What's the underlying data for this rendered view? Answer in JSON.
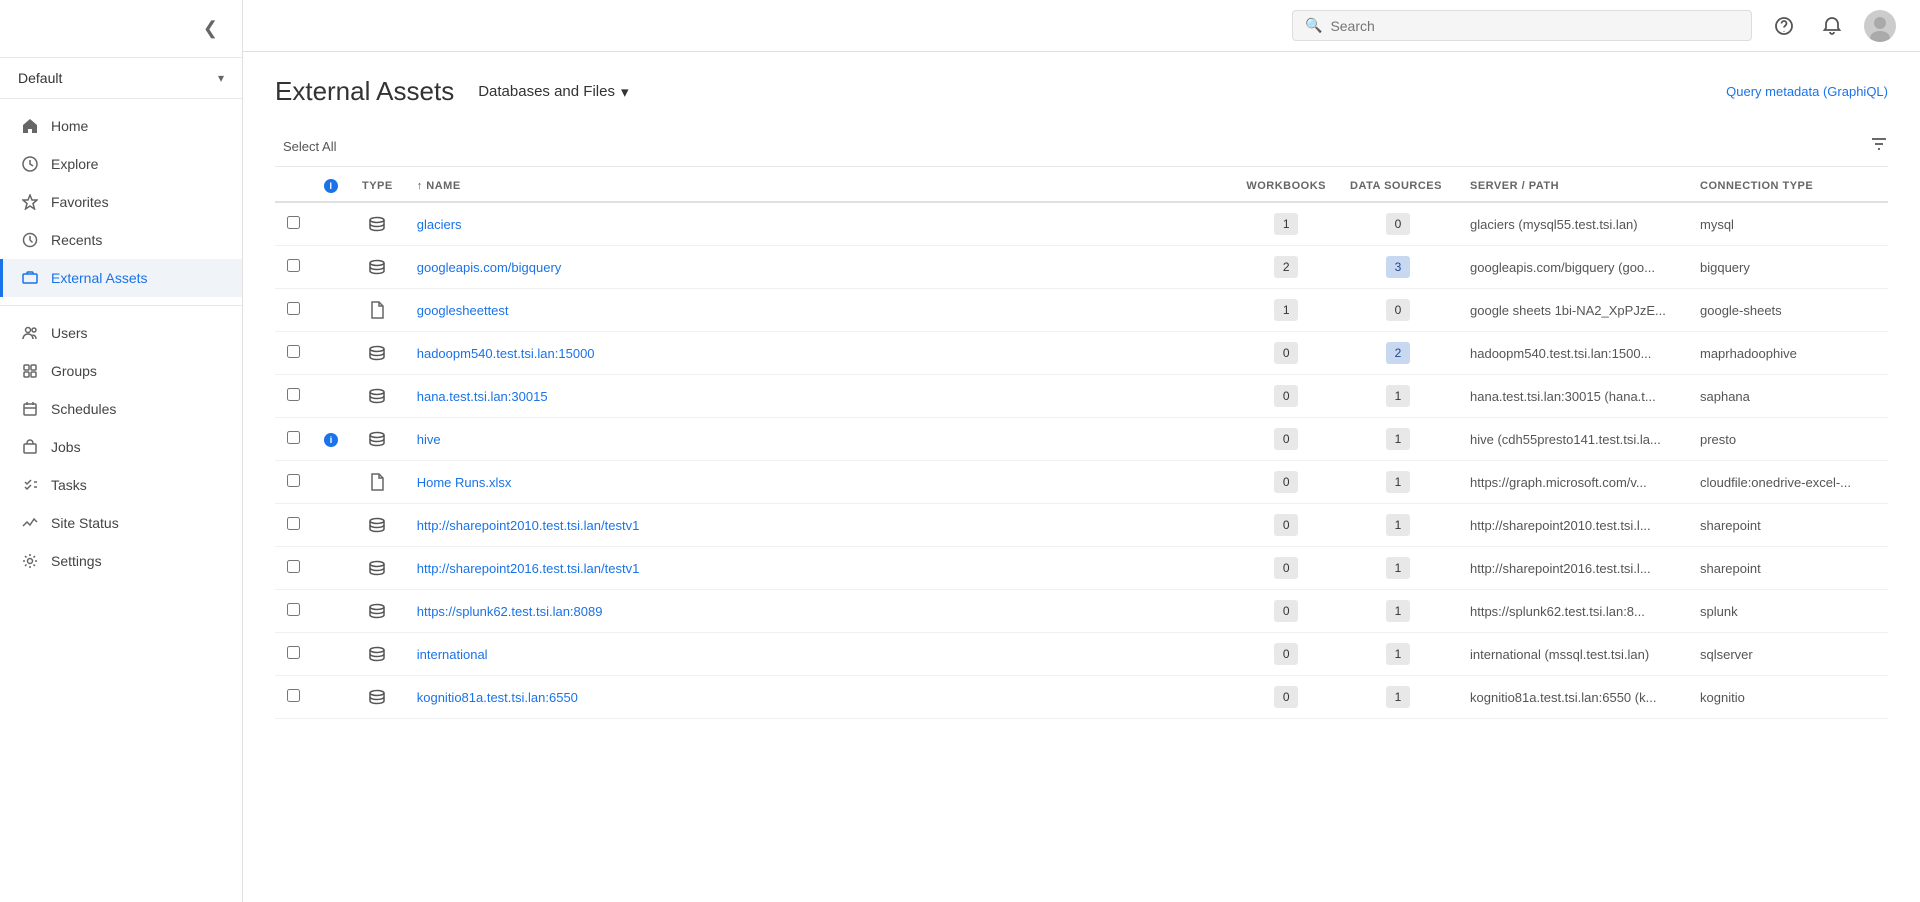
{
  "sidebar": {
    "env_label": "Default",
    "collapse_icon": "❮",
    "nav_items": [
      {
        "id": "home",
        "label": "Home",
        "icon": "home"
      },
      {
        "id": "explore",
        "label": "Explore",
        "icon": "explore"
      },
      {
        "id": "favorites",
        "label": "Favorites",
        "icon": "star"
      },
      {
        "id": "recents",
        "label": "Recents",
        "icon": "clock"
      },
      {
        "id": "external-assets",
        "label": "External Assets",
        "icon": "external",
        "active": true
      }
    ],
    "admin_items": [
      {
        "id": "users",
        "label": "Users",
        "icon": "users"
      },
      {
        "id": "groups",
        "label": "Groups",
        "icon": "groups"
      },
      {
        "id": "schedules",
        "label": "Schedules",
        "icon": "schedules"
      },
      {
        "id": "jobs",
        "label": "Jobs",
        "icon": "jobs"
      },
      {
        "id": "tasks",
        "label": "Tasks",
        "icon": "tasks"
      },
      {
        "id": "site-status",
        "label": "Site Status",
        "icon": "status"
      },
      {
        "id": "settings",
        "label": "Settings",
        "icon": "settings"
      }
    ]
  },
  "topbar": {
    "search_placeholder": "Search"
  },
  "page": {
    "title": "External Assets",
    "dropdown_label": "Databases and Files",
    "graphql_link": "Query metadata (GraphiQL)",
    "select_all_label": "Select All"
  },
  "table": {
    "columns": [
      {
        "id": "checkbox",
        "label": ""
      },
      {
        "id": "info",
        "label": ""
      },
      {
        "id": "type",
        "label": "Type"
      },
      {
        "id": "name",
        "label": "Name",
        "sort": "asc"
      },
      {
        "id": "workbooks",
        "label": "Workbooks"
      },
      {
        "id": "datasources",
        "label": "Data Sources"
      },
      {
        "id": "server",
        "label": "Server / Path"
      },
      {
        "id": "conntype",
        "label": "Connection Type"
      }
    ],
    "rows": [
      {
        "id": 1,
        "type": "database",
        "name": "glaciers",
        "workbooks": 1,
        "workbooks_highlighted": false,
        "datasources": 0,
        "datasources_highlighted": false,
        "server": "glaciers (mysql55.test.tsi.lan)",
        "conntype": "mysql",
        "has_info": false
      },
      {
        "id": 2,
        "type": "database",
        "name": "googleapis.com/bigquery",
        "workbooks": 2,
        "workbooks_highlighted": false,
        "datasources": 3,
        "datasources_highlighted": true,
        "server": "googleapis.com/bigquery (goo...",
        "conntype": "bigquery",
        "has_info": false
      },
      {
        "id": 3,
        "type": "file",
        "name": "googlesheettest",
        "workbooks": 1,
        "workbooks_highlighted": false,
        "datasources": 0,
        "datasources_highlighted": false,
        "server": "google sheets 1bi-NA2_XpPJzE...",
        "conntype": "google-sheets",
        "has_info": false
      },
      {
        "id": 4,
        "type": "database",
        "name": "hadoopm540.test.tsi.lan:15000",
        "workbooks": 0,
        "workbooks_highlighted": false,
        "datasources": 2,
        "datasources_highlighted": true,
        "server": "hadoopm540.test.tsi.lan:1500...",
        "conntype": "maprhadoophive",
        "has_info": false
      },
      {
        "id": 5,
        "type": "database",
        "name": "hana.test.tsi.lan:30015",
        "workbooks": 0,
        "workbooks_highlighted": false,
        "datasources": 1,
        "datasources_highlighted": false,
        "server": "hana.test.tsi.lan:30015 (hana.t...",
        "conntype": "saphana",
        "has_info": false
      },
      {
        "id": 6,
        "type": "database",
        "name": "hive",
        "workbooks": 0,
        "workbooks_highlighted": false,
        "datasources": 1,
        "datasources_highlighted": false,
        "server": "hive (cdh55presto141.test.tsi.la...",
        "conntype": "presto",
        "has_info": true
      },
      {
        "id": 7,
        "type": "file",
        "name": "Home Runs.xlsx",
        "workbooks": 0,
        "workbooks_highlighted": false,
        "datasources": 1,
        "datasources_highlighted": false,
        "server": "https://graph.microsoft.com/v...",
        "conntype": "cloudfile:onedrive-excel-...",
        "has_info": false
      },
      {
        "id": 8,
        "type": "database",
        "name": "http://sharepoint2010.test.tsi.lan/testv1",
        "workbooks": 0,
        "workbooks_highlighted": false,
        "datasources": 1,
        "datasources_highlighted": false,
        "server": "http://sharepoint2010.test.tsi.l...",
        "conntype": "sharepoint",
        "has_info": false
      },
      {
        "id": 9,
        "type": "database",
        "name": "http://sharepoint2016.test.tsi.lan/testv1",
        "workbooks": 0,
        "workbooks_highlighted": false,
        "datasources": 1,
        "datasources_highlighted": false,
        "server": "http://sharepoint2016.test.tsi.l...",
        "conntype": "sharepoint",
        "has_info": false
      },
      {
        "id": 10,
        "type": "database",
        "name": "https://splunk62.test.tsi.lan:8089",
        "workbooks": 0,
        "workbooks_highlighted": false,
        "datasources": 1,
        "datasources_highlighted": false,
        "server": "https://splunk62.test.tsi.lan:8...",
        "conntype": "splunk",
        "has_info": false
      },
      {
        "id": 11,
        "type": "database",
        "name": "international",
        "workbooks": 0,
        "workbooks_highlighted": false,
        "datasources": 1,
        "datasources_highlighted": false,
        "server": "international (mssql.test.tsi.lan)",
        "conntype": "sqlserver",
        "has_info": false
      },
      {
        "id": 12,
        "type": "database",
        "name": "kognitio81a.test.tsi.lan:6550",
        "workbooks": 0,
        "workbooks_highlighted": false,
        "datasources": 1,
        "datasources_highlighted": false,
        "server": "kognitio81a.test.tsi.lan:6550 (k...",
        "conntype": "kognitio",
        "has_info": false
      }
    ]
  }
}
